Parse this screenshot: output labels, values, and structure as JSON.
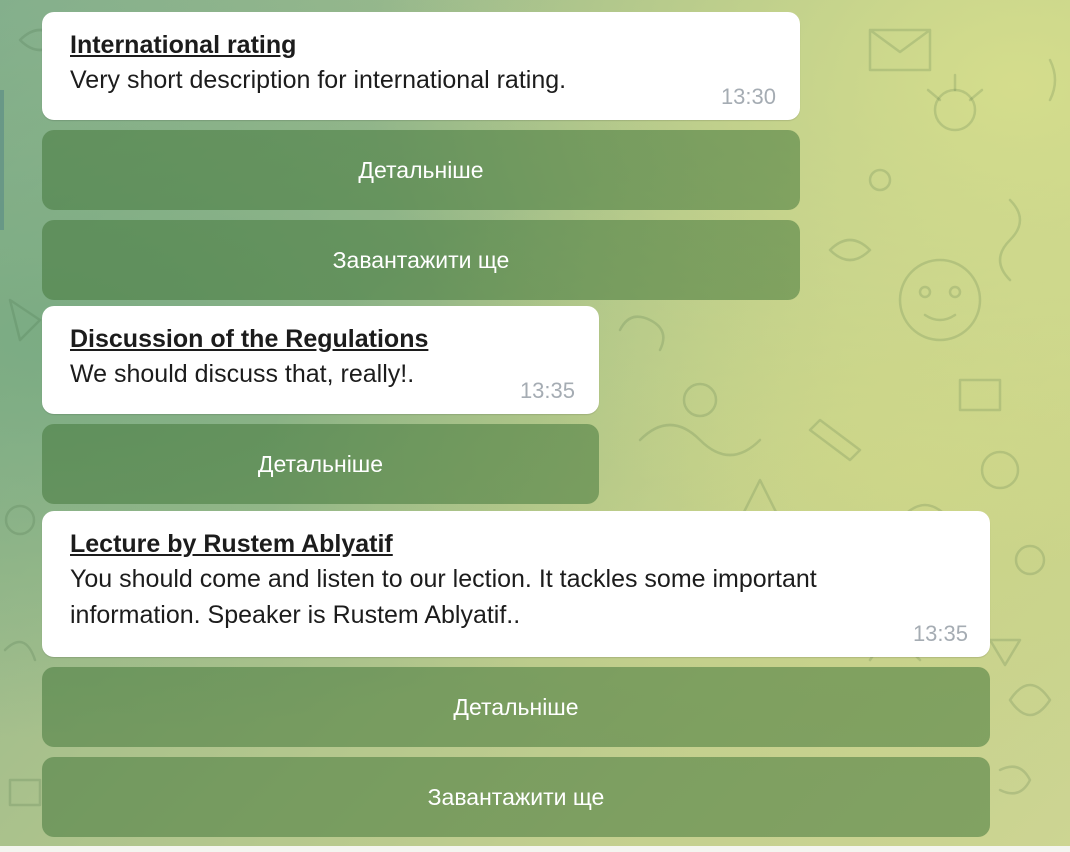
{
  "messages": [
    {
      "title": "International rating",
      "text": "Very short description for international rating.",
      "time": "13:30",
      "buttons": [
        "Детальніше",
        "Завантажити ще"
      ]
    },
    {
      "title": "Discussion of the Regulations",
      "text": "We should discuss that, really!.",
      "time": "13:35",
      "buttons": [
        "Детальніше"
      ]
    },
    {
      "title": "Lecture by Rustem Ablyatif",
      "text": "You should come and listen to our lection. It tackles some important information. Speaker is Rustem Ablyatif..",
      "time": "13:35",
      "buttons": [
        "Детальніше",
        "Завантажити ще"
      ]
    }
  ],
  "colors": {
    "bubble": "#ffffff",
    "button_bg": "#6b9a57",
    "time": "#a5acb3",
    "background_start": "#86b08e",
    "background_end": "#cdd592"
  }
}
